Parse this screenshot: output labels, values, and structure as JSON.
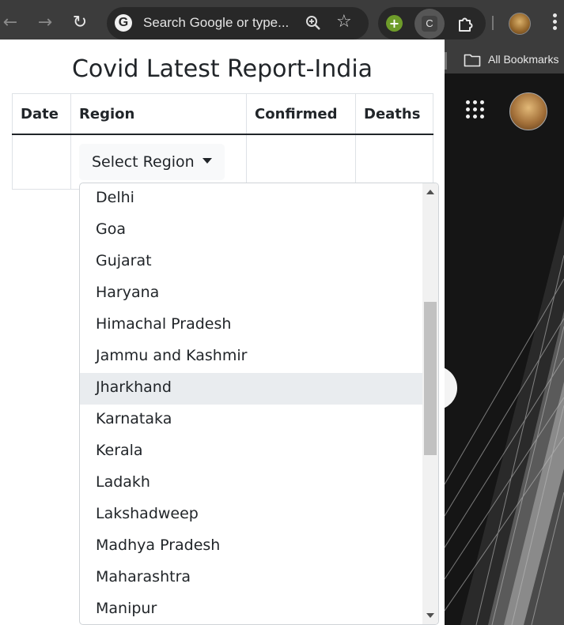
{
  "browser": {
    "omnibox_placeholder": "Search Google or type...",
    "extension_letter": "C",
    "bookmarks_label": "All Bookmarks"
  },
  "app": {
    "title": "Covid Latest Report-India",
    "table": {
      "headers": [
        "Date",
        "Region",
        "Confirmed",
        "Deaths"
      ]
    },
    "select_label": "Select Region",
    "regions": [
      "Delhi",
      "Goa",
      "Gujarat",
      "Haryana",
      "Himachal Pradesh",
      "Jammu and Kashmir",
      "Jharkhand",
      "Karnataka",
      "Kerala",
      "Ladakh",
      "Lakshadweep",
      "Madhya Pradesh",
      "Maharashtra",
      "Manipur"
    ],
    "highlighted_region": "Jharkhand"
  },
  "colors": {
    "chrome_bar": "#3c3c3c",
    "highlight": "#e9ecef"
  }
}
